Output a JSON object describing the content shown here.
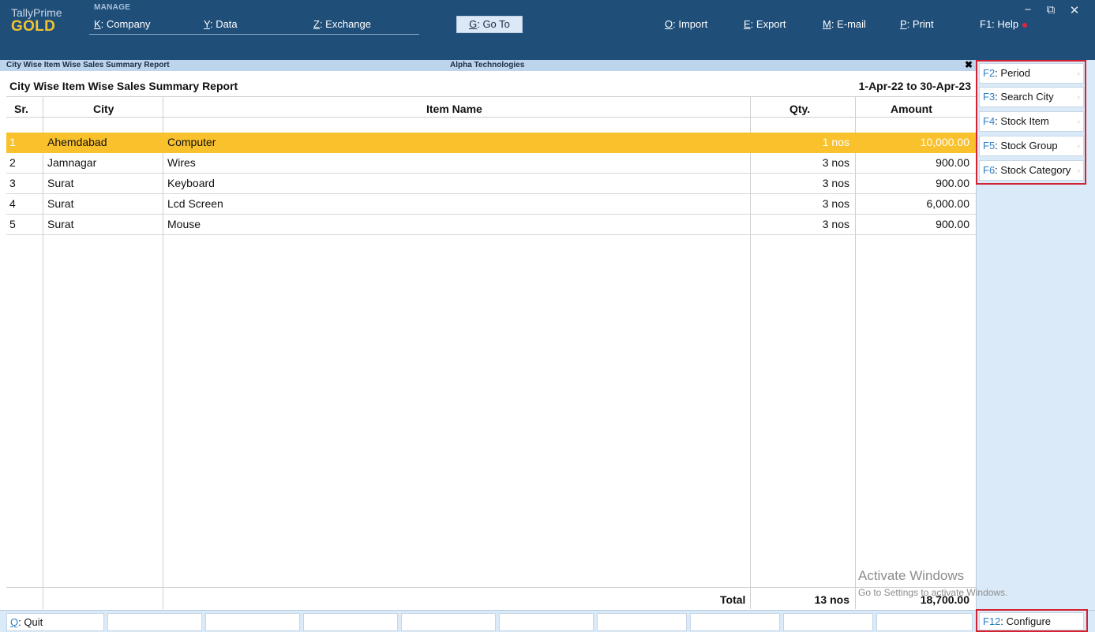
{
  "app": {
    "name": "TallyPrime",
    "edition": "GOLD",
    "manage_label": "MANAGE"
  },
  "menu": {
    "company": {
      "key": "K",
      "label": ": Company"
    },
    "data": {
      "key": "Y",
      "label": ": Data"
    },
    "exchange": {
      "key": "Z",
      "label": ": Exchange"
    },
    "goto": {
      "key": "G",
      "label": ": Go To"
    },
    "import": {
      "key": "O",
      "label": ": Import"
    },
    "export": {
      "key": "E",
      "label": ": Export"
    },
    "email": {
      "key": "M",
      "label": ": E-mail"
    },
    "print": {
      "key": "P",
      "label": ": Print"
    },
    "help": {
      "key": "F1",
      "label": ": Help"
    }
  },
  "window_controls": {
    "minimize": "−",
    "restore": "⧉",
    "close": "✕"
  },
  "title_strip": {
    "report_name": "City Wise Item Wise Sales Summary Report",
    "company": "Alpha Technologies",
    "close": "✖"
  },
  "report": {
    "title": "City Wise Item Wise Sales Summary Report",
    "period": "1-Apr-22 to 30-Apr-23",
    "columns": {
      "sr": "Sr.",
      "city": "City",
      "item": "Item Name",
      "qty": "Qty.",
      "amount": "Amount"
    },
    "rows": [
      {
        "sr": "1",
        "city": "Ahemdabad",
        "item": "Computer",
        "qty": "1 nos",
        "amount": "10,000.00",
        "selected": true
      },
      {
        "sr": "2",
        "city": "Jamnagar",
        "item": "Wires",
        "qty": "3 nos",
        "amount": "900.00"
      },
      {
        "sr": "3",
        "city": "Surat",
        "item": "Keyboard",
        "qty": "3 nos",
        "amount": "900.00"
      },
      {
        "sr": "4",
        "city": "Surat",
        "item": "Lcd Screen",
        "qty": "3 nos",
        "amount": "6,000.00"
      },
      {
        "sr": "5",
        "city": "Surat",
        "item": "Mouse",
        "qty": "3 nos",
        "amount": "900.00"
      }
    ],
    "total": {
      "label": "Total",
      "qty": "13 nos",
      "amount": "18,700.00"
    }
  },
  "side_panel": [
    {
      "key": "F2",
      "label": ": Period"
    },
    {
      "key": "F3",
      "label": ": Search City"
    },
    {
      "key": "F4",
      "label": ": Stock Item"
    },
    {
      "key": "F5",
      "label": ": Stock Group"
    },
    {
      "key": "F6",
      "label": ": Stock Category"
    }
  ],
  "bottom": {
    "quit": {
      "key": "Q",
      "label": ": Quit"
    },
    "configure": {
      "key": "F12",
      "label": ": Configure"
    }
  },
  "watermark": {
    "line1": "Activate Windows",
    "line2": "Go to Settings to activate Windows."
  },
  "colors": {
    "topbar": "#1f4e79",
    "highlight_row": "#f9c12b",
    "side_panel": "#dbeaf8",
    "annotation_box": "#d32230",
    "fkey_text": "#2b7fc7"
  }
}
